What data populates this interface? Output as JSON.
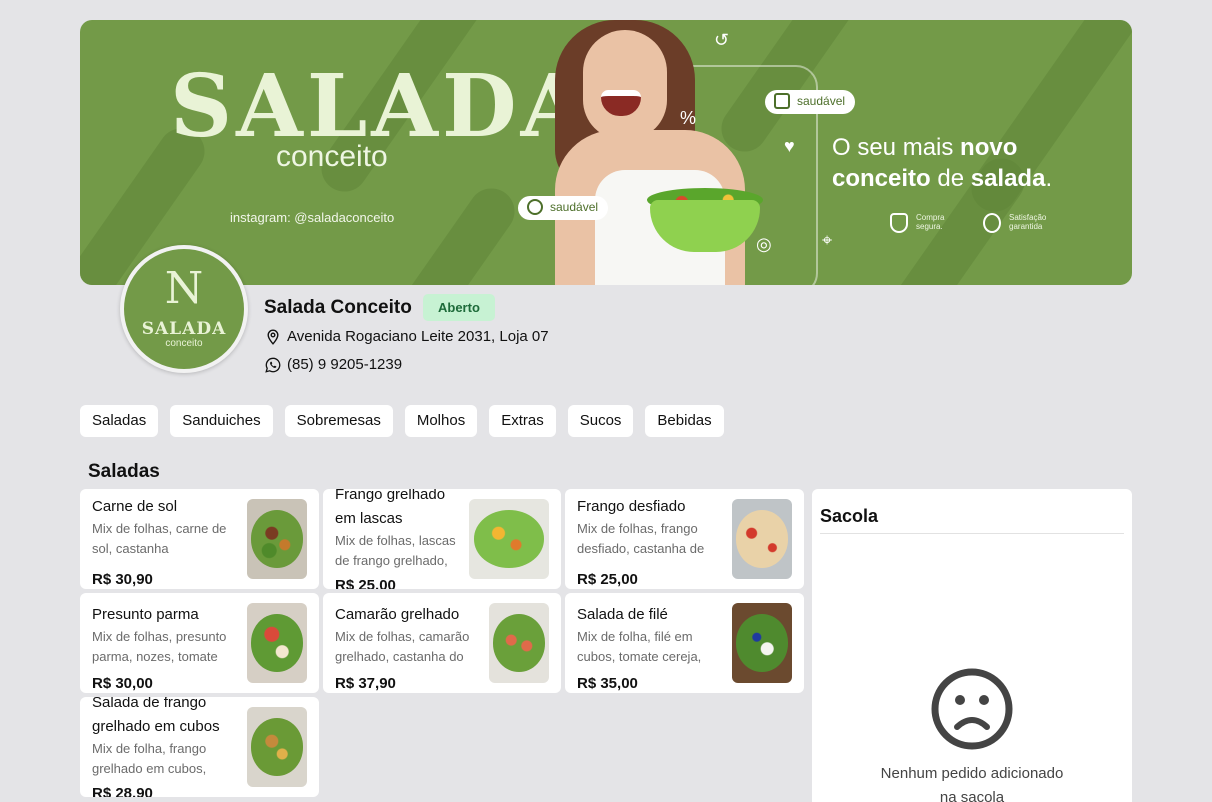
{
  "banner": {
    "title": "SALADA",
    "subtitle": "conceito",
    "instagram": "instagram: @saladaconceito",
    "pill_label": "saudável",
    "tagline_pre": "O seu mais ",
    "tagline_bold1": "novo",
    "tagline_bold2": "conceito",
    "tagline_mid": " de ",
    "tagline_bold3": "salada",
    "tagline_end": ".",
    "badge1": "Compra segura.",
    "badge2": "Satisfação garantida",
    "brand_color": "#739a48"
  },
  "store": {
    "logo_mono": "N",
    "logo_name": "SALADA",
    "logo_sub": "conceito",
    "name": "Salada Conceito",
    "status": "Aberto",
    "address": "Avenida Rogaciano Leite 2031, Loja 07",
    "phone": "(85) 9 9205-1239",
    "address_icon": "map-pin-icon",
    "phone_icon": "whatsapp-icon"
  },
  "categories": [
    "Saladas",
    "Sanduiches",
    "Sobremesas",
    "Molhos",
    "Extras",
    "Sucos",
    "Bebidas"
  ],
  "section_title": "Saladas",
  "products": [
    {
      "name": "Carne de sol",
      "desc": "Mix de folhas, carne de sol, castanha",
      "price": "R$ 30,90"
    },
    {
      "name": "Frango grelhado em lascas",
      "desc": "Mix de folhas, lascas de frango grelhado,",
      "price": "R$ 25,00"
    },
    {
      "name": "Frango desfiado",
      "desc": "Mix de folhas, frango desfiado, castanha de",
      "price": "R$ 25,00"
    },
    {
      "name": "Presunto parma",
      "desc": "Mix de folhas, presunto parma, nozes, tomate",
      "price": "R$ 30,00"
    },
    {
      "name": "Camarão grelhado",
      "desc": "Mix de folhas, camarão grelhado, castanha do",
      "price": "R$ 37,90"
    },
    {
      "name": "Salada de filé",
      "desc": "Mix de folha, filé em cubos, tomate cereja,",
      "price": "R$ 35,00"
    },
    {
      "name": "Salada de frango grelhado em cubos",
      "desc": "Mix de folha, frango grelhado em cubos,",
      "price": "R$ 28,90"
    }
  ],
  "bag": {
    "title": "Sacola",
    "empty_icon": "sad-face-icon",
    "empty_message": "Nenhum pedido adicionado na sacola"
  }
}
